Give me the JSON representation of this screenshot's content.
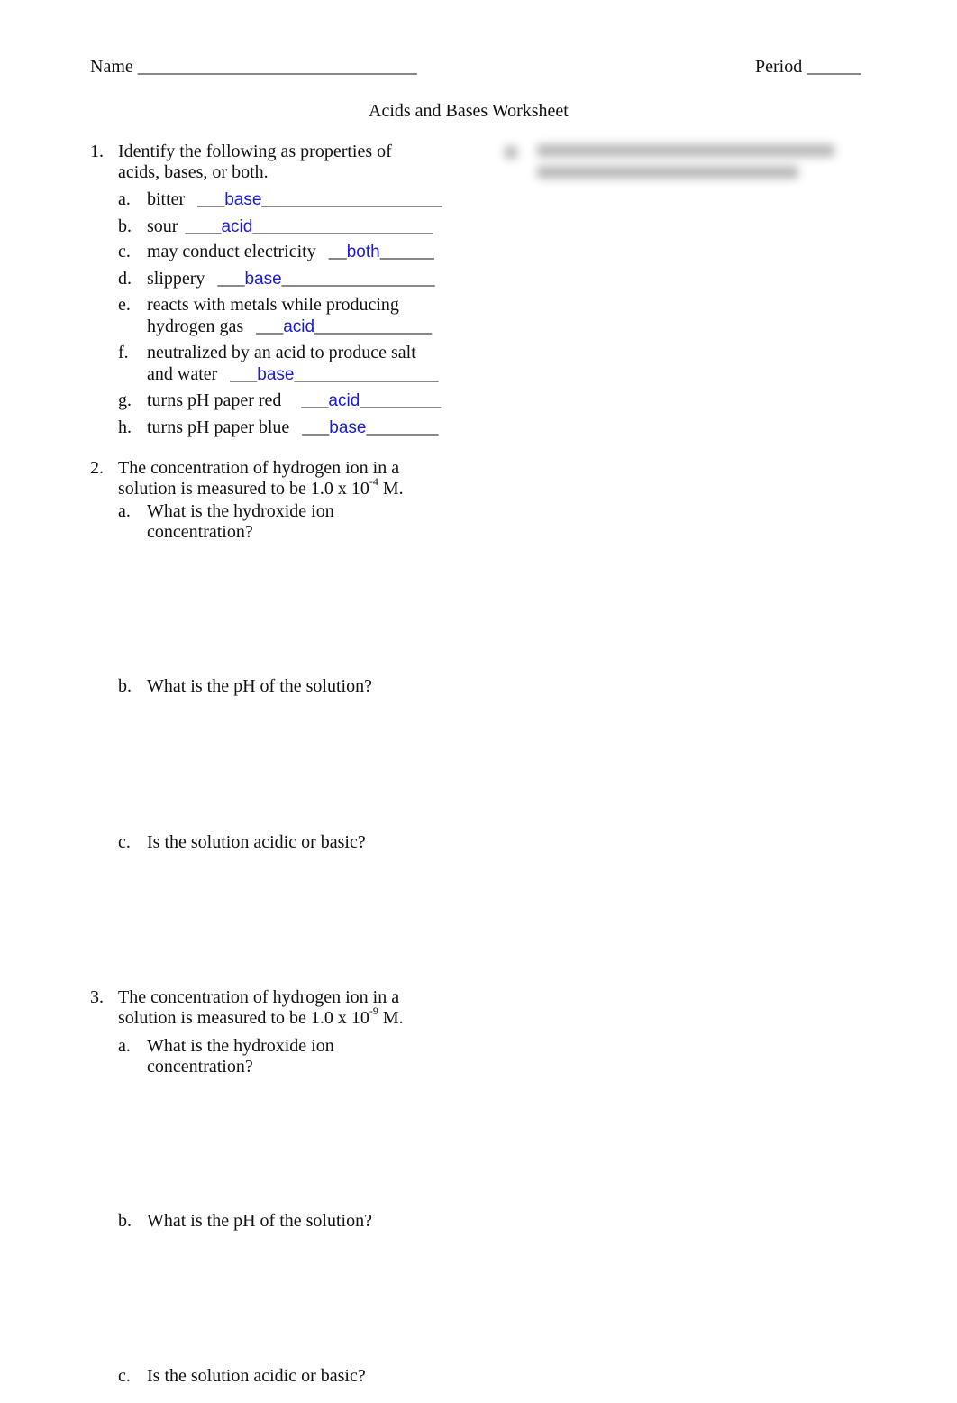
{
  "header": {
    "name_label": "Name",
    "name_blank": "_______________________________",
    "period_label": "Period",
    "period_blank": "______"
  },
  "title": "Acids and Bases Worksheet",
  "q1": {
    "number": "1.",
    "prompt_line1": "Identify the following as properties of",
    "prompt_line2": "acids, bases, or both.",
    "items": [
      {
        "letter": "a.",
        "text": "bitter",
        "pre": "___",
        "answer": "base",
        "post": "____________________"
      },
      {
        "letter": "b.",
        "text": "sour",
        "pre": "____",
        "answer": "acid",
        "post": "____________________"
      },
      {
        "letter": "c.",
        "text": "may conduct electricity",
        "pre": "__",
        "answer": "both",
        "post": "______"
      },
      {
        "letter": "d.",
        "text": "slippery",
        "pre": "___",
        "answer": "base",
        "post": "_________________"
      },
      {
        "letter": "e.",
        "text": "reacts with metals while producing",
        "text2": "hydrogen gas",
        "pre": "___",
        "answer": "acid",
        "post": "_____________"
      },
      {
        "letter": "f.",
        "text": "neutralized by an acid to produce salt",
        "text2": "and water",
        "pre": "___",
        "answer": "base",
        "post": "________________"
      },
      {
        "letter": "g.",
        "text": "turns pH paper red",
        "pre": "___",
        "answer": "acid",
        "post": "_________"
      },
      {
        "letter": "h.",
        "text": "turns pH paper blue",
        "pre": "___",
        "answer": "base",
        "post": "________"
      }
    ]
  },
  "q2": {
    "number": "2.",
    "prompt_line1": "The concentration of hydrogen ion in a",
    "prompt_line2_pre": "solution is measured to be 1.0 x 10",
    "exponent": "-4",
    "prompt_line2_post": " M.",
    "a_letter": "a.",
    "a_line1": "What is the hydroxide ion",
    "a_line2": "concentration?",
    "b_letter": "b.",
    "b_text": "What is the pH of the solution?",
    "c_letter": "c.",
    "c_text": "Is the solution acidic or basic?"
  },
  "q3": {
    "number": "3.",
    "prompt_line1": "The concentration of hydrogen ion in a",
    "prompt_line2_pre": "solution is measured to be 1.0 x 10",
    "exponent": "-9",
    "prompt_line2_post": " M.",
    "a_letter": "a.",
    "a_line1": "What is the hydroxide ion",
    "a_line2": "concentration?",
    "b_letter": "b.",
    "b_text": "What is the pH of the solution?",
    "c_letter": "c.",
    "c_text": "Is the solution acidic or basic?"
  }
}
